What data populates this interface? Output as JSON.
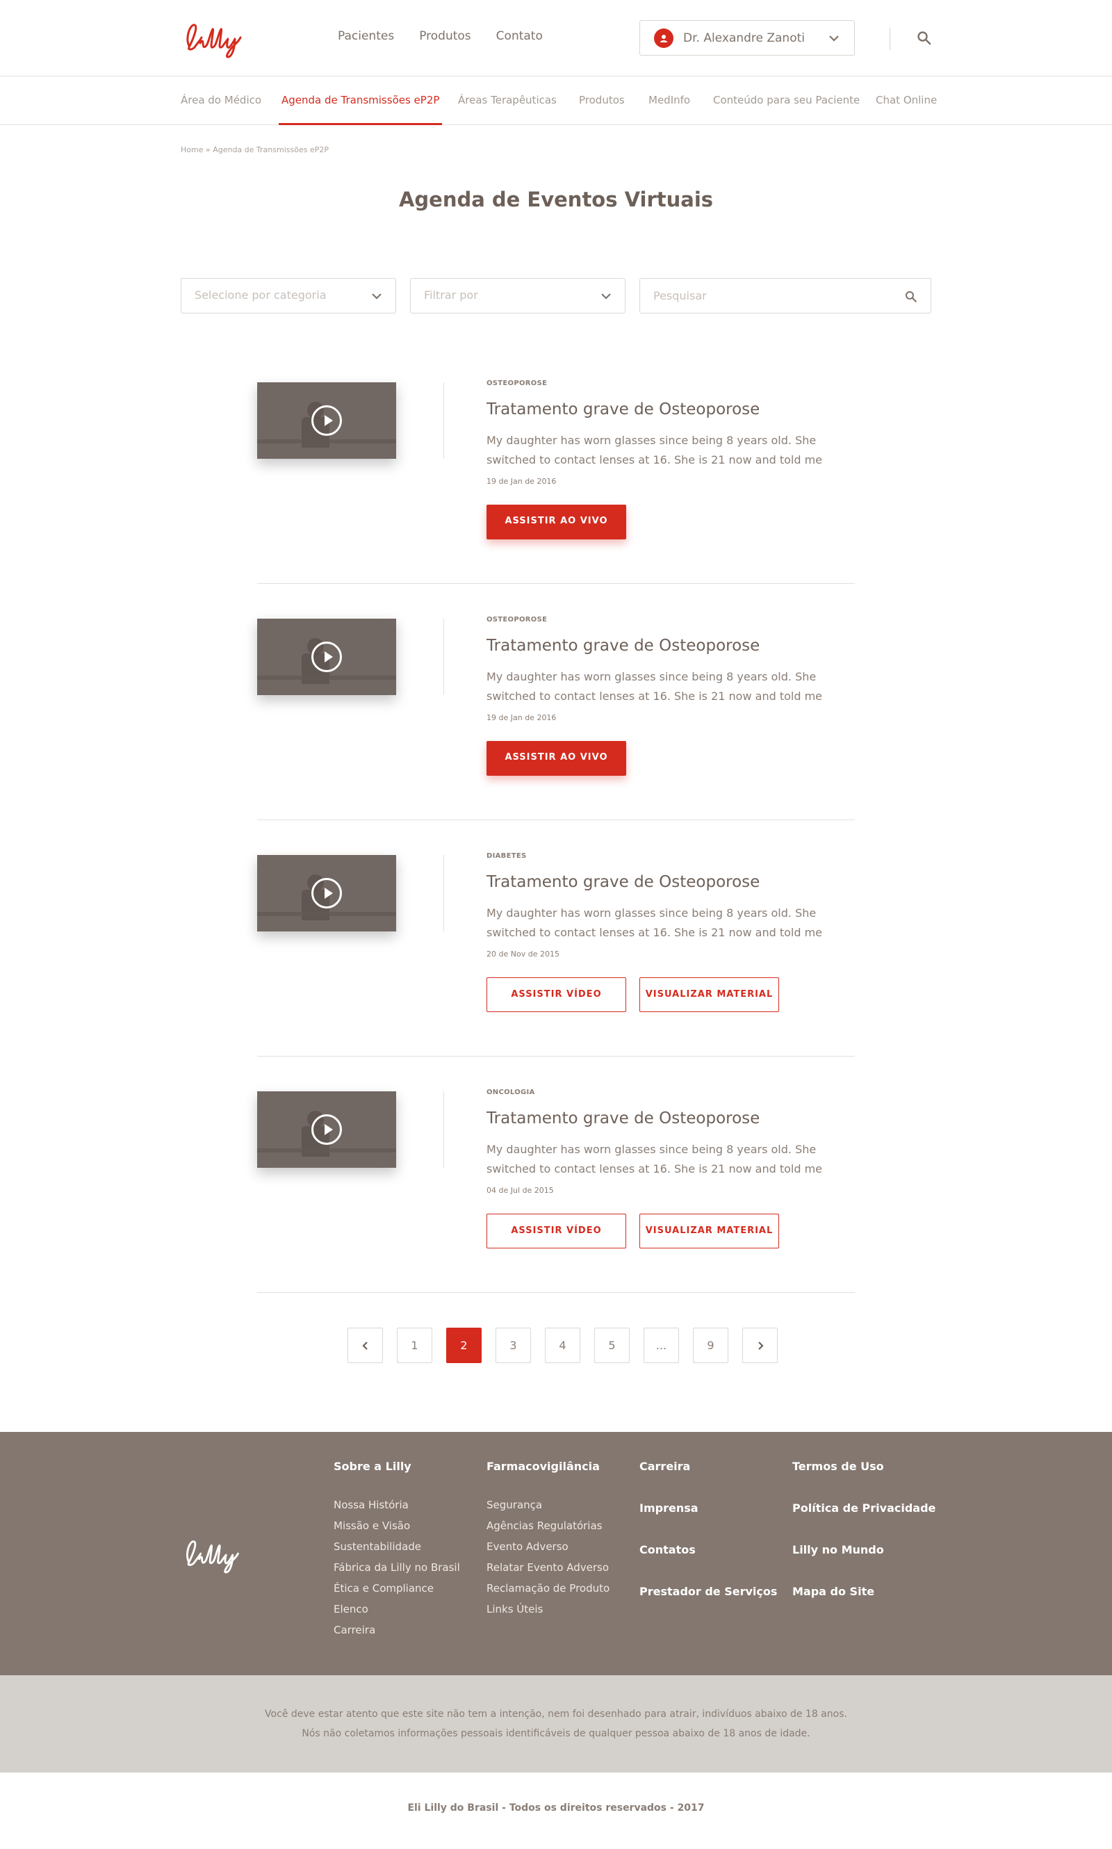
{
  "header": {
    "logo_text": "Lilly",
    "nav": [
      "Pacientes",
      "Produtos",
      "Contato"
    ],
    "user_name": "Dr. Alexandre Zanoti"
  },
  "sub_nav": [
    "Área do Médico",
    "Agenda de Transmissões eP2P",
    "Áreas Terapêuticas",
    "Produtos",
    "MedInfo",
    "Conteúdo para seu Paciente",
    "Chat Online"
  ],
  "sub_nav_active": "Agenda de Transmissões eP2P",
  "breadcrumb": "Home » Agenda de Transmissões eP2P",
  "page_title": "Agenda de Eventos Virtuais",
  "filters": {
    "category_placeholder": "Selecione por categoria",
    "filter_placeholder": "Filtrar por",
    "search_placeholder": "Pesquisar"
  },
  "events": [
    {
      "category": "OSTEOPOROSE",
      "title": "Tratamento grave de Osteoporose",
      "desc1": "My daughter has worn glasses since being 8 years old. She",
      "desc2": "switched to contact lenses at 16. She is 21 now and told me",
      "date": "19 de Jan de 2016",
      "button": "ASSISTIR AO VIVO"
    },
    {
      "category": "OSTEOPOROSE",
      "title": "Tratamento grave de Osteoporose",
      "desc1": "My daughter has worn glasses since being 8 years old. She",
      "desc2": "switched to contact lenses at 16. She is 21 now and told me",
      "date": "19 de Jan de 2016",
      "button": "ASSISTIR AO VIVO"
    },
    {
      "category": "DIABETES",
      "title": "Tratamento grave de Osteoporose",
      "desc1": "My daughter has worn glasses since being 8 years old. She",
      "desc2": "switched to contact lenses at 16. She is 21 now and told me",
      "date": "20 de Nov de 2015",
      "button": "ASSISTIR VÍDEO",
      "button2": "VISUALIZAR MATERIAL"
    },
    {
      "category": "ONCOLOGIA",
      "title": "Tratamento grave de Osteoporose",
      "desc1": "My daughter has worn glasses since being 8 years old. She",
      "desc2": "switched to contact lenses at 16. She is 21 now and told me",
      "date": "04 de Jul de 2015",
      "button": "ASSISTIR VÍDEO",
      "button2": "VISUALIZAR MATERIAL"
    }
  ],
  "pagination": {
    "pages": [
      "1",
      "2",
      "3",
      "4",
      "5",
      "...",
      "9"
    ],
    "current": "2"
  },
  "footer": {
    "col1": {
      "title": "Sobre a Lilly",
      "links": [
        "Nossa História",
        "Missão e Visão",
        "Sustentabilidade",
        "Fábrica da Lilly no Brasil",
        "Ética e Compliance",
        "Elenco",
        "Carreira"
      ]
    },
    "col2": {
      "title": "Farmacovigilância",
      "links": [
        "Segurança",
        "Agências Regulatórias",
        "Evento Adverso",
        "Relatar Evento Adverso",
        "Reclamação de Produto",
        "Links Úteis"
      ]
    },
    "col3": [
      "Carreira",
      "Imprensa",
      "Contatos",
      "Prestador de Serviços"
    ],
    "col4": [
      "Termos de Uso",
      "Política de Privacidade",
      "Lilly no Mundo",
      "Mapa do Site"
    ]
  },
  "disclaimer": {
    "line1": "Você deve estar atento que este site não tem a intenção, nem foi desenhado para atrair, indivíduos abaixo de 18 anos.",
    "line2": "Nós não coletamos informações pessoais identificáveis de qualquer pessoa abaixo de 18 anos de idade."
  },
  "copyright": "Eli Lilly do Brasil - Todos os direitos reservados - 2017",
  "colors": {
    "accent": "#d52b1e",
    "footer_bg": "#847770",
    "disclaimer_bg": "#d4d0cb"
  }
}
